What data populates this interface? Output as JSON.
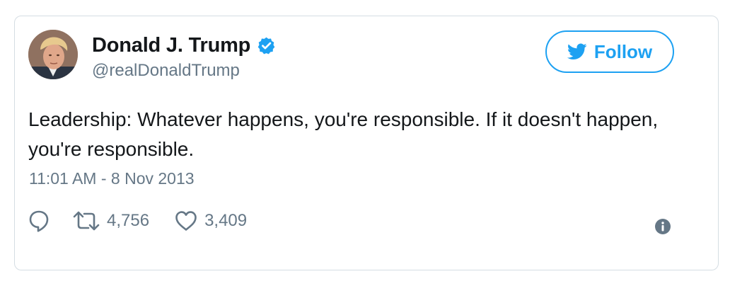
{
  "user": {
    "display_name": "Donald J. Trump",
    "handle": "@realDonaldTrump",
    "verified": true
  },
  "follow_button": {
    "label": "Follow",
    "icon": "twitter-bird-icon"
  },
  "tweet": {
    "text": "Leadership: Whatever happens, you're responsible. If it doesn't happen, you're responsible.",
    "timestamp": "11:01 AM - 8 Nov 2013"
  },
  "actions": {
    "reply_icon": "reply-icon",
    "retweet_count": "4,756",
    "like_count": "3,409",
    "info_icon": "info-icon"
  },
  "colors": {
    "accent": "#1da1f2",
    "text": "#14171a",
    "secondary": "#657786",
    "border": "#d5dde3"
  }
}
